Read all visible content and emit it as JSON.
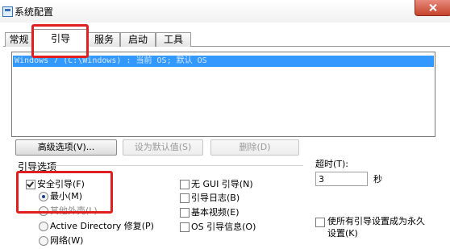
{
  "window": {
    "title": "系统配置"
  },
  "tabs": [
    {
      "label": "常规"
    },
    {
      "label": "引导"
    },
    {
      "label": "服务"
    },
    {
      "label": "启动"
    },
    {
      "label": "工具"
    }
  ],
  "boot_list": {
    "entries": [
      "Windows 7 (C:\\Windows) : 当前 OS; 默认 OS"
    ]
  },
  "buttons": {
    "advanced": "高级选项(V)...",
    "set_default": "设为默认值(S)",
    "delete": "删除(D)"
  },
  "boot_options": {
    "label": "引导选项",
    "safe_boot": {
      "label": "安全引导(F)",
      "checked": true
    },
    "radios": [
      {
        "label": "最小(M)",
        "selected": true
      },
      {
        "label": "其他外壳(L)",
        "selected": false
      },
      {
        "label": "Active Directory 修复(P)",
        "selected": false
      },
      {
        "label": "网络(W)",
        "selected": false
      }
    ],
    "checkboxes": [
      {
        "label": "无 GUI 引导(N)",
        "checked": false
      },
      {
        "label": "引导日志(B)",
        "checked": false
      },
      {
        "label": "基本视频(E)",
        "checked": false
      },
      {
        "label": "OS 引导信息(O)",
        "checked": false
      }
    ]
  },
  "timeout": {
    "label": "超时(T):",
    "value": "3",
    "unit": "秒"
  },
  "permanent": {
    "label_line1": "使所有引导设置成为永久",
    "label_line2": "设置(K)",
    "checked": false
  },
  "colors": {
    "selection": "#3399ff",
    "highlight_box": "#e02020"
  }
}
